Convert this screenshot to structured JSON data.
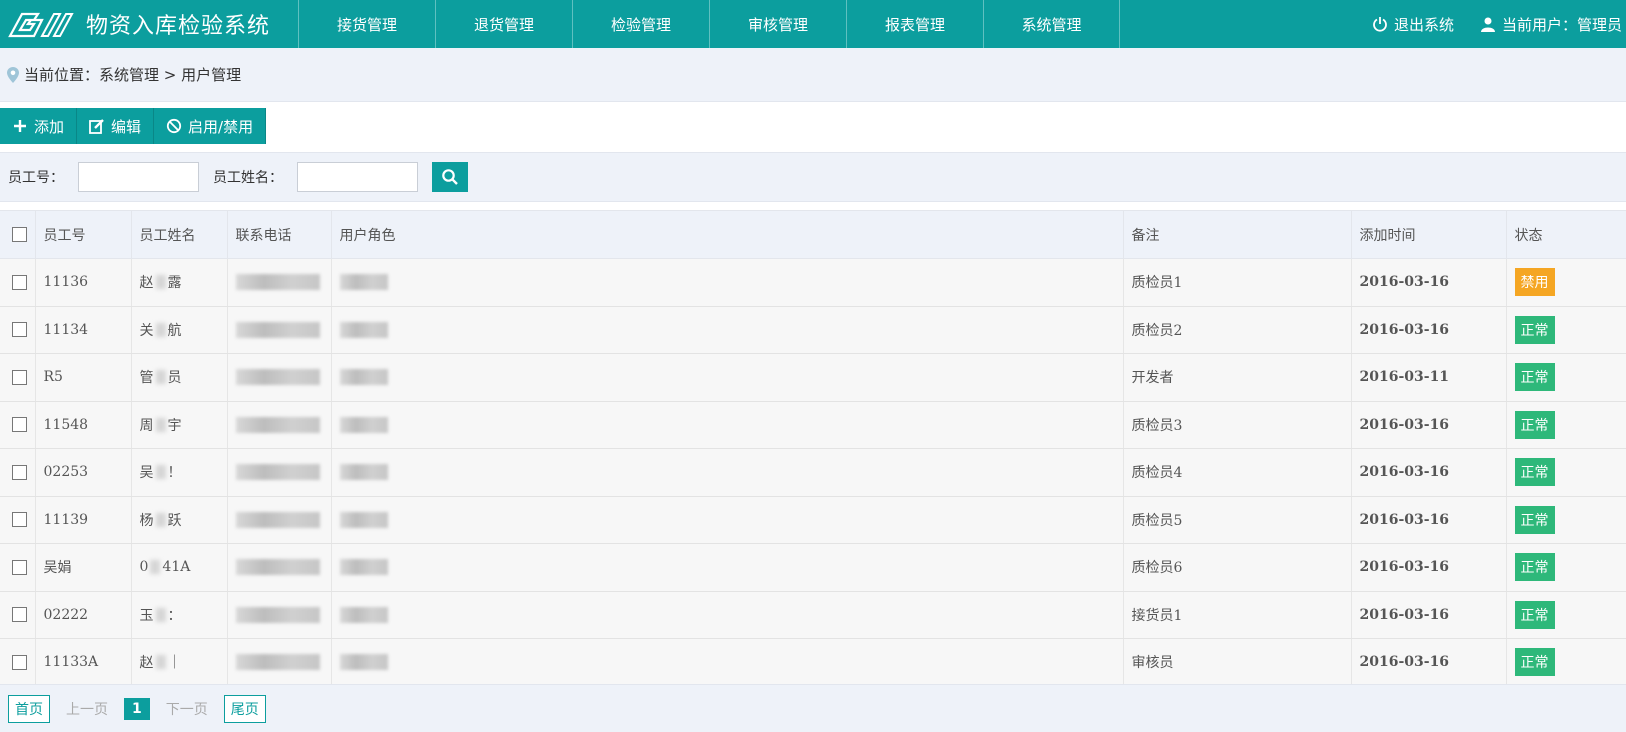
{
  "header": {
    "app_title": "物资入库检验系统",
    "nav": [
      "接货管理",
      "退货管理",
      "检验管理",
      "审核管理",
      "报表管理",
      "系统管理"
    ],
    "logout_label": "退出系统",
    "current_user_label": "当前用户：管理员"
  },
  "breadcrumb": {
    "text": "当前位置：系统管理 > 用户管理"
  },
  "toolbar": {
    "add_label": "添加",
    "edit_label": "编辑",
    "toggle_label": "启用/禁用"
  },
  "search": {
    "emp_id_label": "员工号：",
    "emp_name_label": "员工姓名：",
    "emp_id_value": "",
    "emp_name_value": ""
  },
  "table": {
    "columns": [
      "员工号",
      "员工姓名",
      "联系电话",
      "用户角色",
      "备注",
      "添加时间",
      "状态"
    ],
    "rows": [
      {
        "id": "11136",
        "name_a": "赵",
        "name_b": "露",
        "note": "质检员1",
        "date": "2016-03-16",
        "status": "禁用",
        "status_type": "disabled"
      },
      {
        "id": "11134",
        "name_a": "关",
        "name_b": "航",
        "note": "质检员2",
        "date": "2016-03-16",
        "status": "正常",
        "status_type": "ok"
      },
      {
        "id": "R5",
        "name_a": "管",
        "name_b": "员",
        "note": "开发者",
        "date": "2016-03-11",
        "status": "正常",
        "status_type": "ok"
      },
      {
        "id": "11548",
        "name_a": "周",
        "name_b": "宇",
        "note": "质检员3",
        "date": "2016-03-16",
        "status": "正常",
        "status_type": "ok"
      },
      {
        "id": "02253",
        "name_a": "吴",
        "name_b": "！",
        "note": "质检员4",
        "date": "2016-03-16",
        "status": "正常",
        "status_type": "ok"
      },
      {
        "id": "11139",
        "name_a": "杨",
        "name_b": "跃",
        "note": "质检员5",
        "date": "2016-03-16",
        "status": "正常",
        "status_type": "ok"
      },
      {
        "id": "吴娟",
        "name_a": "0",
        "name_b": "41A",
        "note": "质检员6",
        "date": "2016-03-16",
        "status": "正常",
        "status_type": "ok"
      },
      {
        "id": "02222",
        "name_a": "玉",
        "name_b": "：",
        "note": "接货员1",
        "date": "2016-03-16",
        "status": "正常",
        "status_type": "ok"
      },
      {
        "id": "11133A",
        "name_a": "赵",
        "name_b": "｜",
        "note": "审核员",
        "date": "2016-03-16",
        "status": "正常",
        "status_type": "ok"
      }
    ]
  },
  "pager": {
    "first": "首页",
    "prev": "上一页",
    "current": "1",
    "next": "下一页",
    "last": "尾页"
  },
  "colors": {
    "accent": "#0c9e9e",
    "ok": "#2eb87a",
    "disabled": "#f5a623"
  }
}
